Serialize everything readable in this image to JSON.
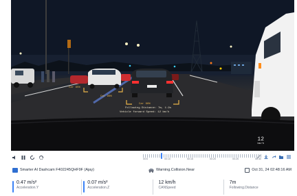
{
  "video": {
    "speed_overlay": {
      "value": "12",
      "unit": "km/h"
    },
    "detections": [
      {
        "label": "Car 95%"
      },
      {
        "label": "Car 96%"
      },
      {
        "label": "Car 96%"
      },
      {
        "label": "Following Distance: 7m, 1.9s"
      },
      {
        "label": "Vehicle forward Speed: 12 km/h"
      }
    ]
  },
  "timeline": {
    "tick_labels": [
      "00:5",
      "00:10",
      "00:15",
      "00:20",
      "00:25",
      "00:30"
    ],
    "progress": 0.15
  },
  "info": {
    "device": "Smarter AI Dashcam F402245QHF9F (Ajay)",
    "event": "Warning.Collision.Near",
    "timestamp": "Oct 31, 24 02:48:16 AM"
  },
  "metrics": [
    {
      "value": "0.47 m/s²",
      "label": "Acceleration.Y"
    },
    {
      "value": "0.07 m/s²",
      "label": "Acceleration.Z"
    },
    {
      "value": "12 km/h",
      "label": "CANSpeed"
    },
    {
      "value": "7m",
      "label": "Following.Distance"
    }
  ],
  "colors": {
    "accent": "#3b82f6",
    "box": "#e8b34a",
    "brand": "#2f6fd1"
  }
}
